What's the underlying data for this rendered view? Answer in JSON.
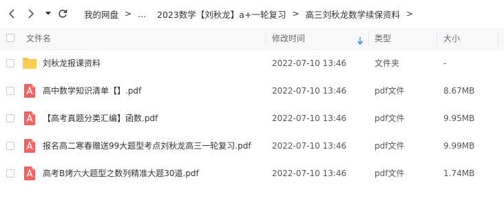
{
  "nav": {
    "icons": [
      "back-icon",
      "forward-icon",
      "dropdown-icon",
      "refresh-icon"
    ]
  },
  "breadcrumb": {
    "items": [
      "我的网盘",
      "...",
      "2023数学【刘秋龙】a+一轮复习",
      "高三刘秋龙数学续保资料"
    ],
    "separator": ">"
  },
  "table": {
    "headers": {
      "name": "文件名",
      "mtime": "修改时间",
      "type": "类型",
      "size": "大小"
    },
    "sort_indicator": "down-arrow-icon",
    "rows": [
      {
        "icon": "folder-icon",
        "name": "刘秋龙报课资料",
        "mtime": "2022-07-10 13:46",
        "type": "文件夹",
        "size": "-"
      },
      {
        "icon": "pdf-icon",
        "name": "高中数学知识清单【】.pdf",
        "mtime": "2022-07-10 13:46",
        "type": "pdf文件",
        "size": "8.67MB"
      },
      {
        "icon": "pdf-icon",
        "name": "【高考真题分类汇编】函数.pdf",
        "mtime": "2022-07-10 13:46",
        "type": "pdf文件",
        "size": "9.95MB"
      },
      {
        "icon": "pdf-icon",
        "name": "报名高二寒春赠送99大题型考点刘秋龙高三一轮复习.pdf",
        "mtime": "2022-07-10 13:46",
        "type": "pdf文件",
        "size": "9.99MB"
      },
      {
        "icon": "pdf-icon",
        "name": "高考B烤六大题型之数列精准大题30道.pdf",
        "mtime": "2022-07-10 13:46",
        "type": "pdf文件",
        "size": "1.74MB"
      }
    ]
  },
  "colors": {
    "folder": "#f8c244",
    "pdf": "#f2605f",
    "sort_arrow": "#2c8cf0",
    "header_bg": "#f7f8fa"
  }
}
